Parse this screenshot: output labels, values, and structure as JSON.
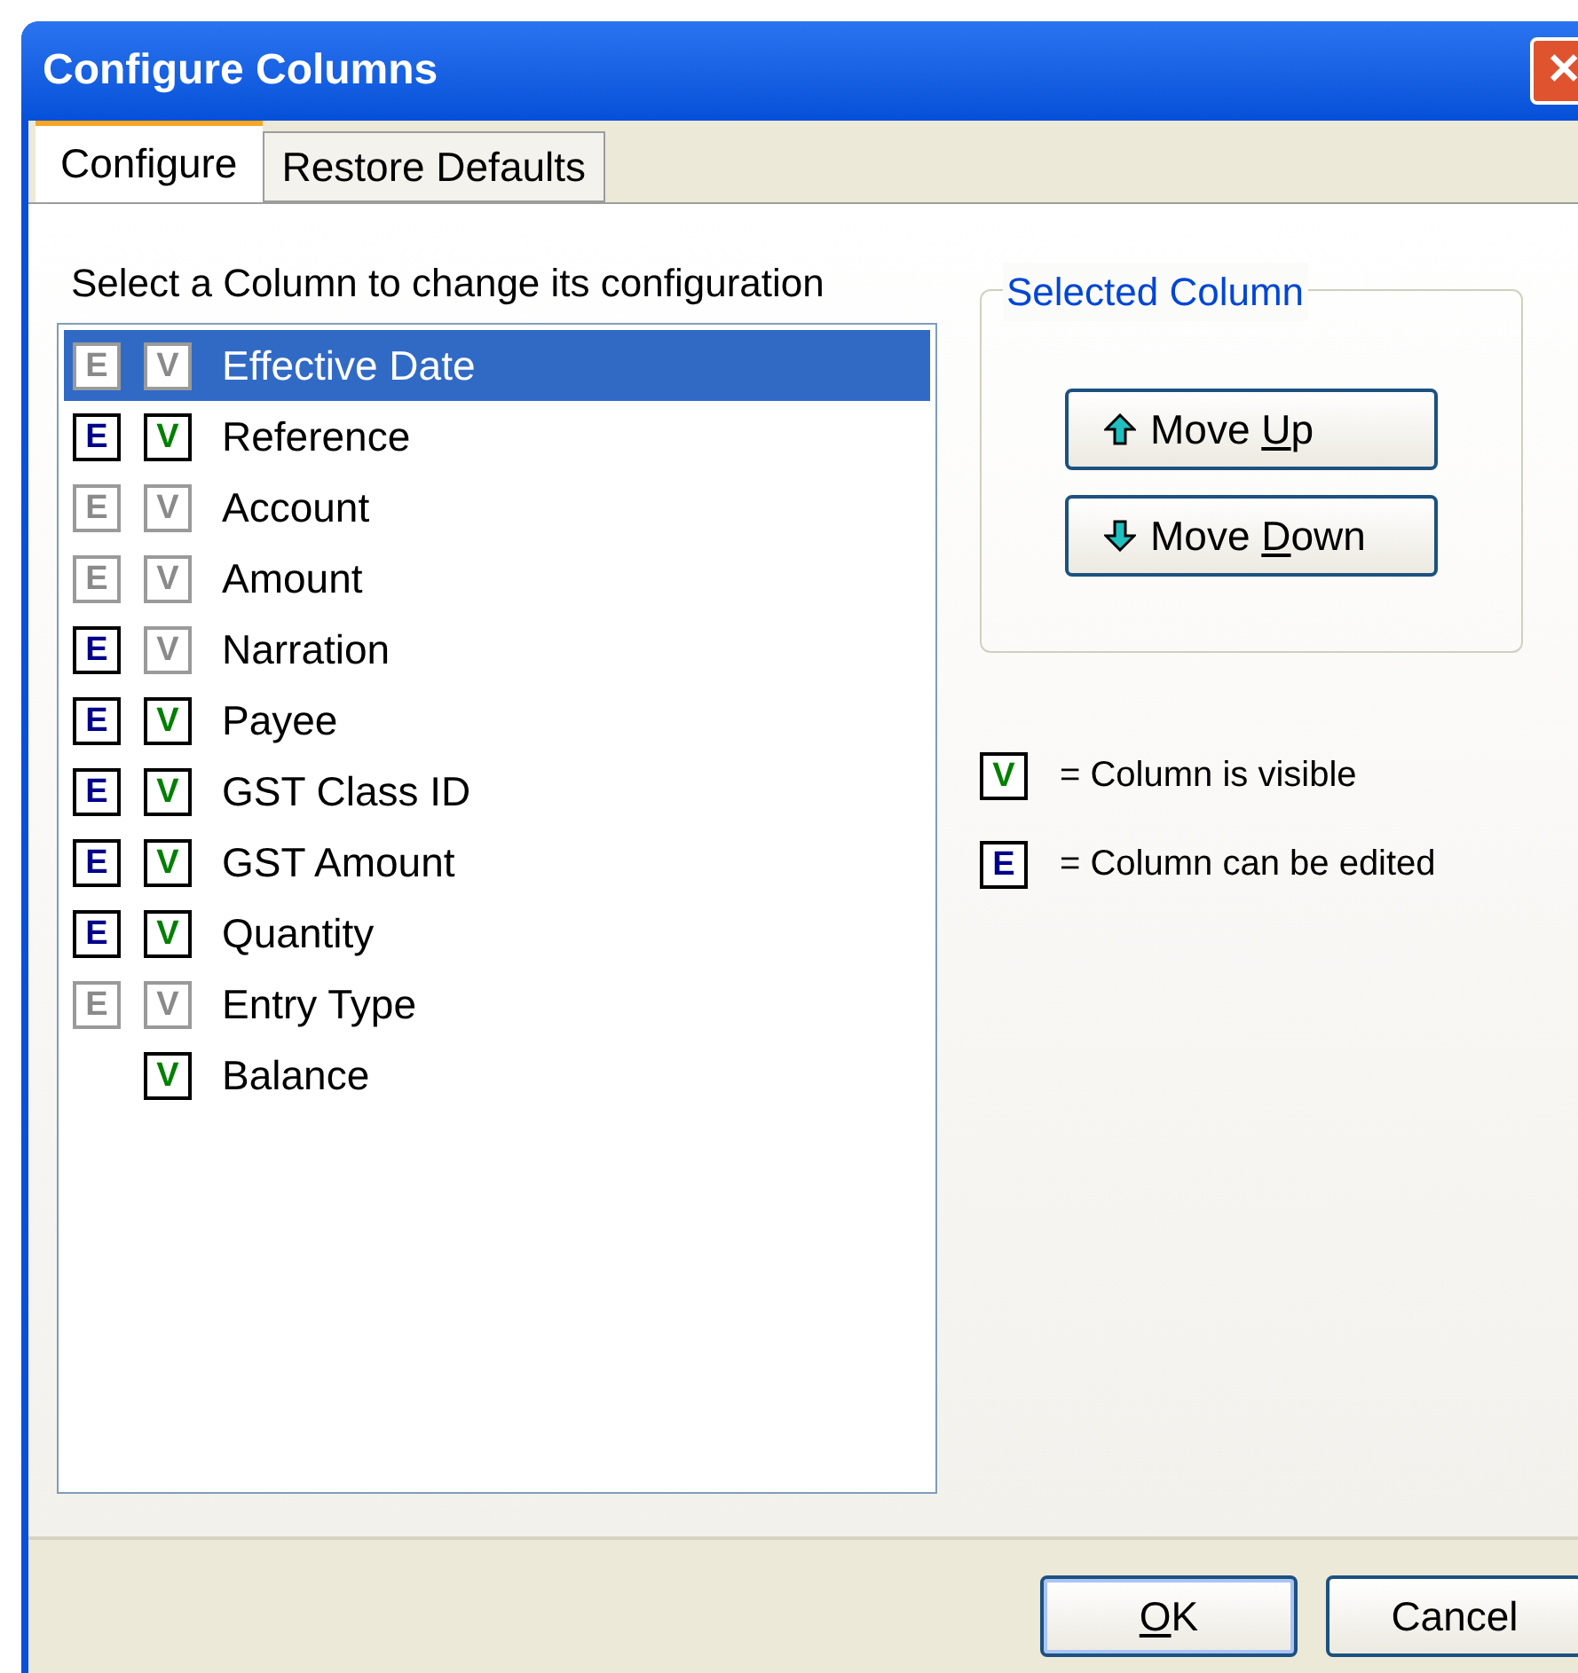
{
  "window": {
    "title": "Configure Columns",
    "close": "✕"
  },
  "tabs": [
    {
      "label": "Configure",
      "selected": true
    },
    {
      "label": "Restore Defaults",
      "selected": false
    }
  ],
  "instruction": "Select a Column to change its configuration",
  "columns": [
    {
      "label": "Effective Date",
      "selected": true,
      "edit": {
        "glyph": "E",
        "on": false
      },
      "visible": {
        "glyph": "V",
        "on": false
      }
    },
    {
      "label": "Reference",
      "selected": false,
      "edit": {
        "glyph": "E",
        "on": true
      },
      "visible": {
        "glyph": "V",
        "on": true
      }
    },
    {
      "label": "Account",
      "selected": false,
      "edit": {
        "glyph": "E",
        "on": false
      },
      "visible": {
        "glyph": "V",
        "on": false
      }
    },
    {
      "label": "Amount",
      "selected": false,
      "edit": {
        "glyph": "E",
        "on": false
      },
      "visible": {
        "glyph": "V",
        "on": false
      }
    },
    {
      "label": "Narration",
      "selected": false,
      "edit": {
        "glyph": "E",
        "on": true
      },
      "visible": {
        "glyph": "V",
        "on": false
      }
    },
    {
      "label": "Payee",
      "selected": false,
      "edit": {
        "glyph": "E",
        "on": true
      },
      "visible": {
        "glyph": "V",
        "on": true
      }
    },
    {
      "label": "GST Class ID",
      "selected": false,
      "edit": {
        "glyph": "E",
        "on": true
      },
      "visible": {
        "glyph": "V",
        "on": true
      }
    },
    {
      "label": "GST Amount",
      "selected": false,
      "edit": {
        "glyph": "E",
        "on": true
      },
      "visible": {
        "glyph": "V",
        "on": true
      }
    },
    {
      "label": "Quantity",
      "selected": false,
      "edit": {
        "glyph": "E",
        "on": true
      },
      "visible": {
        "glyph": "V",
        "on": true
      }
    },
    {
      "label": "Entry Type",
      "selected": false,
      "edit": {
        "glyph": "E",
        "on": false
      },
      "visible": {
        "glyph": "V",
        "on": false
      }
    },
    {
      "label": "Balance",
      "selected": false,
      "visible": {
        "glyph": "V",
        "on": true
      }
    }
  ],
  "selected_column": {
    "title": "Selected Column",
    "buttons": [
      {
        "kind": "up",
        "label_start": "Move ",
        "access_key": "U",
        "label_end": "p"
      },
      {
        "kind": "down",
        "label_start": "Move ",
        "access_key": "D",
        "label_end": "own"
      }
    ]
  },
  "legend": [
    {
      "kind": "visible",
      "glyph": "V",
      "text": "= Column is visible"
    },
    {
      "kind": "edit",
      "glyph": "E",
      "text": "= Column can be edited"
    }
  ],
  "footer_buttons": [
    {
      "access_key": "O",
      "label_end": "K",
      "default": true
    },
    {
      "label_end": "Cancel",
      "default": false
    }
  ]
}
